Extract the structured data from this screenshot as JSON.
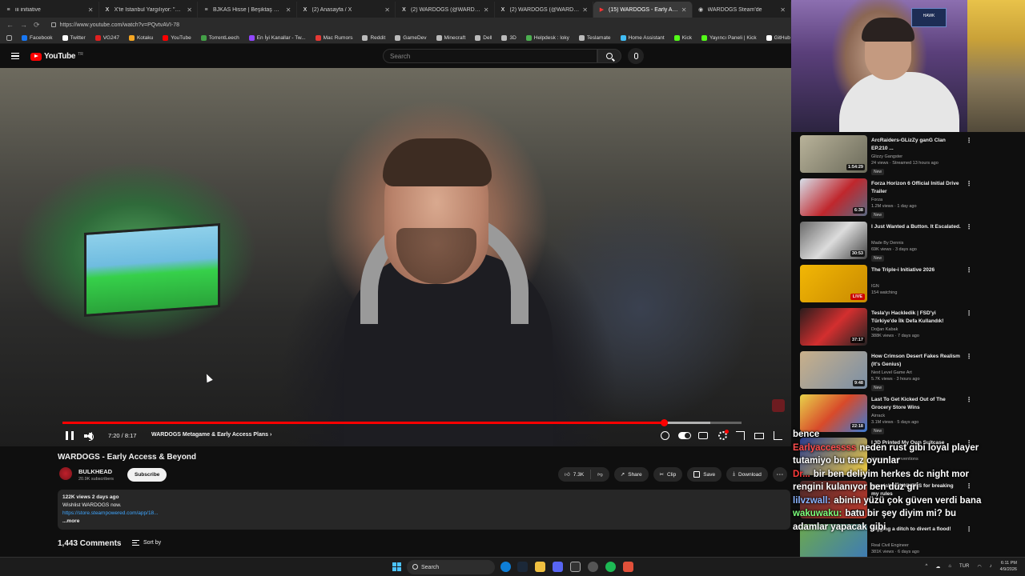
{
  "browser": {
    "tabs": [
      {
        "icon": "lines-icon",
        "title": "iii initiative",
        "active": false
      },
      {
        "icon": "x-logo-icon",
        "title": "X'te İstanbul Yargılıyor: \"CANLI BL...",
        "active": false
      },
      {
        "icon": "bikas-icon",
        "title": "BJKAS Hisse | Beşiktaş Fiyatları - In...",
        "active": false
      },
      {
        "icon": "x-logo-icon",
        "title": "(2) Anasayfa / X",
        "active": false
      },
      {
        "icon": "x-logo-icon",
        "title": "(2) WARDOGS (@WARDOGS) / X",
        "active": false
      },
      {
        "icon": "x-logo-icon",
        "title": "(2) WARDOGS (@WARDOGS) / X",
        "active": false
      },
      {
        "icon": "youtube-icon",
        "title": "(15) WARDOGS - Early Acce...",
        "active": true
      },
      {
        "icon": "steam-icon",
        "title": "WARDOGS Steam'de",
        "active": false
      }
    ],
    "url": "https://www.youtube.com/watch?v=PQvtvAVI-78",
    "bookmarks": [
      {
        "label": "Facebook",
        "color": "#1877f2"
      },
      {
        "label": "Twitter",
        "color": "#ffffff"
      },
      {
        "label": "VG247",
        "color": "#e02020"
      },
      {
        "label": "Kotaku",
        "color": "#f5a623"
      },
      {
        "label": "YouTube",
        "color": "#ff0000"
      },
      {
        "label": "TorrentLeech",
        "color": "#43a047"
      },
      {
        "label": "En İyi Kanallar - Tw...",
        "color": "#9146ff"
      },
      {
        "label": "Mac Rumors",
        "color": "#e53935"
      },
      {
        "label": "Reddit",
        "color": "#bbbbbb"
      },
      {
        "label": "GameDev",
        "color": "#bbbbbb"
      },
      {
        "label": "Minecraft",
        "color": "#bbbbbb"
      },
      {
        "label": "Dell",
        "color": "#bbbbbb"
      },
      {
        "label": "3D",
        "color": "#bbbbbb"
      },
      {
        "label": "Helpdesk : loky",
        "color": "#4caf50"
      },
      {
        "label": "Teslamate",
        "color": "#bbbbbb"
      },
      {
        "label": "Home Assistant",
        "color": "#41bdf5"
      },
      {
        "label": "Kick",
        "color": "#53fc18"
      },
      {
        "label": "Yayıncı Paneli | Kick",
        "color": "#53fc18"
      },
      {
        "label": "GitHub - obsprojec...",
        "color": "#ffffff"
      }
    ]
  },
  "youtube": {
    "logo_text": "YouTube",
    "country_code": "TR",
    "search_placeholder": "Search"
  },
  "player": {
    "time": "7:20 / 8:17",
    "chapter": "WARDOGS Metagame & Early Access Plans",
    "progress": 0.8853,
    "buffered": 0.9545
  },
  "video": {
    "title": "WARDOGS - Early Access & Beyond",
    "channel": "BULKHEAD",
    "subscribers": "20.9K subscribers",
    "subscribe_label": "Subscribe",
    "likes": "7.3K",
    "share_label": "Share",
    "clip_label": "Clip",
    "save_label": "Save",
    "download_label": "Download",
    "views_date": "122K views  2 days ago",
    "desc_line": "Wishlist WARDOGS now.",
    "desc_link": "https://store.steampowered.com/app/18...",
    "more_label": "...more",
    "comment_count": "1,443 Comments",
    "sort_label": "Sort by"
  },
  "webcam": {
    "sign_text": "HAWK"
  },
  "recommendations": [
    {
      "title": "ArcRaiders-GLizZy ganG Clan EP.210 ...",
      "channel": "Glizzy Gangster",
      "meta": "24 views · Streamed 13 hours ago",
      "badge": "New",
      "duration": "1:54:29",
      "thumb": "linear-gradient(135deg,#b9b39a,#6b6a5a)"
    },
    {
      "title": "Forza Horizon 6 Official Initial Drive Trailer",
      "channel": "Forza",
      "meta": "1.2M views · 1 day ago",
      "badge": "New",
      "duration": "6:38",
      "thumb": "linear-gradient(135deg,#d7dfe9,#c0272d 55%,#5a6a82)"
    },
    {
      "title": "I Just Wanted a Button. It Escalated.",
      "channel": "Made By Dennis",
      "meta": "69K views · 3 days ago",
      "badge": "New",
      "duration": "30:53",
      "thumb": "linear-gradient(135deg,#6a6a6a,#dcdcdc 50%,#444)"
    },
    {
      "title": "The Triple-i Initiative 2026",
      "channel": "IGN",
      "meta": "154 watching",
      "badge": "",
      "duration": "LIVE",
      "thumb": "linear-gradient(135deg,#f2b705,#c98a00)"
    },
    {
      "title": "Tesla'yı Hackledik | FSD'yi Türkiye'de İlk Defa Kullandık!",
      "channel": "Doğan Kabak",
      "meta": "388K views · 7 days ago",
      "badge": "",
      "duration": "37:17",
      "thumb": "linear-gradient(135deg,#2a1c1c,#d32f2f 50%,#222)"
    },
    {
      "title": "How Crimson Desert Fakes Realism (It's Genius)",
      "channel": "Next Level Game Art",
      "meta": "5.7K views · 3 hours ago",
      "badge": "New",
      "duration": "9:48",
      "thumb": "linear-gradient(135deg,#c9b08a,#7a8fa6)"
    },
    {
      "title": "Last To Get Kicked Out of The Grocery Store Wins",
      "channel": "Airrack",
      "meta": "3.1M views · 5 days ago",
      "badge": "New",
      "duration": "22:18",
      "thumb": "linear-gradient(135deg,#e8d24a,#d84a2a 50%,#3a7bd5)"
    },
    {
      "title": "I 3D Printed My Own Suitcase",
      "channel": "Unnecessary Inventions",
      "meta": "",
      "badge": "",
      "duration": "",
      "thumb": "linear-gradient(135deg,#2a3c8f,#f4d03f)"
    },
    {
      "title": "I punished SINNERS for breaking my rules",
      "channel": "",
      "meta": "",
      "badge": "",
      "duration": "37:03",
      "thumb": "linear-gradient(135deg,#4a2a2a,#c0392b)"
    },
    {
      "title": "Digging a ditch to divert a flood!",
      "channel": "Real Civil Engineer",
      "meta": "381K views · 6 days ago",
      "badge": "",
      "duration": "",
      "thumb": "linear-gradient(135deg,#6ba84f,#3d7ab8)"
    }
  ],
  "chat": [
    {
      "user": "",
      "user_color": "#ff5a5a",
      "message": "bence"
    },
    {
      "user": "Earlyaccessss",
      "user_color": "#ff4d4d",
      "message": "neden rust gibi loyal player tutamiyo bu tarz oyunlar"
    },
    {
      "user": "Dr...",
      "user_color": "#ff3b3b",
      "message": "bir ben deliyim herkes dc night mor rengini kulanıyor ben düz gri"
    },
    {
      "user": "lilvzwall:",
      "user_color": "#8ab4ff",
      "message": "abinin yüzü çok güven verdi bana"
    },
    {
      "user": "wakuwaku:",
      "user_color": "#7cff7c",
      "message": "batu bir şey diyim mi? bu adamlar yapacak gibi"
    }
  ],
  "taskbar": {
    "search_label": "Search",
    "language": "TUR",
    "time": "6:11 PM",
    "date": "4/9/2026"
  }
}
